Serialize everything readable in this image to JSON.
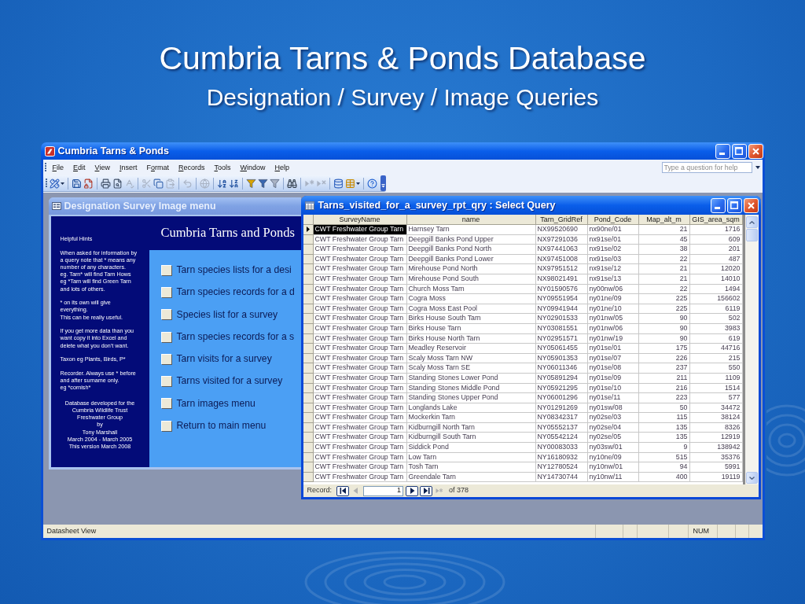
{
  "slide": {
    "title": "Cumbria Tarns & Ponds Database",
    "subtitle": "Designation / Survey / Image Queries"
  },
  "app_window": {
    "title": "Cumbria Tarns & Ponds",
    "menu": [
      {
        "key": "F",
        "post": "ile"
      },
      {
        "key": "E",
        "post": "dit"
      },
      {
        "key": "V",
        "post": "iew"
      },
      {
        "key": "I",
        "post": "nsert"
      },
      {
        "pre": "F",
        "key": "o",
        "post": "rmat"
      },
      {
        "key": "R",
        "post": "ecords"
      },
      {
        "key": "T",
        "post": "ools"
      },
      {
        "key": "W",
        "post": "indow"
      },
      {
        "key": "H",
        "post": "elp"
      }
    ],
    "help_box": {
      "placeholder": "Type a question for help"
    },
    "toolbar": [
      {
        "kind": "view",
        "disabled": false
      },
      {
        "kind": "separator"
      },
      {
        "kind": "save",
        "disabled": false
      },
      {
        "kind": "permission",
        "disabled": false
      },
      {
        "kind": "separator"
      },
      {
        "kind": "print",
        "disabled": false
      },
      {
        "kind": "preview",
        "disabled": false
      },
      {
        "kind": "spelling",
        "disabled": true
      },
      {
        "kind": "separator"
      },
      {
        "kind": "cut",
        "disabled": true
      },
      {
        "kind": "copy",
        "disabled": false
      },
      {
        "kind": "paste",
        "disabled": true
      },
      {
        "kind": "separator"
      },
      {
        "kind": "undo",
        "disabled": true
      },
      {
        "kind": "separator"
      },
      {
        "kind": "hyperlink",
        "disabled": true
      },
      {
        "kind": "separator"
      },
      {
        "kind": "sort_asc",
        "disabled": false
      },
      {
        "kind": "sort_desc",
        "disabled": false
      },
      {
        "kind": "separator"
      },
      {
        "kind": "filter_selection",
        "disabled": false
      },
      {
        "kind": "filter_form",
        "disabled": false
      },
      {
        "kind": "apply_filter",
        "disabled": true
      },
      {
        "kind": "separator"
      },
      {
        "kind": "find",
        "disabled": false
      },
      {
        "kind": "separator"
      },
      {
        "kind": "new_record",
        "disabled": true
      },
      {
        "kind": "delete_record",
        "disabled": true
      },
      {
        "kind": "separator"
      },
      {
        "kind": "database",
        "disabled": false
      },
      {
        "kind": "new_object",
        "disabled": false
      },
      {
        "kind": "separator"
      },
      {
        "kind": "help",
        "disabled": false
      }
    ]
  },
  "form_window": {
    "title": "Designation Survey Image menu",
    "hints": [
      {
        "kind": "heading",
        "lines": [
          "Helpful Hints"
        ]
      },
      {
        "kind": "paragraph",
        "lines": [
          "When asked for information by",
          "a query note that * means any",
          "number of any characters.",
          "eg. Tarn* will find Tarn Hows",
          "eg *Tarn will find Green Tarn",
          "and lots of others."
        ]
      },
      {
        "kind": "paragraph",
        "lines": [
          "* on its own will give",
          "everything.",
          "This can be really useful."
        ]
      },
      {
        "kind": "paragraph",
        "lines": [
          "If you get more data than you",
          "want copy it into Excel and",
          "delete what you don't want."
        ]
      },
      {
        "kind": "paragraph",
        "lines": [
          "Taxon eg Plants, Birds, P*"
        ]
      },
      {
        "kind": "paragraph",
        "lines": [
          "Recorder. Always use * before",
          "and after surname only.",
          "eg *cornish*"
        ]
      },
      {
        "kind": "credits",
        "lines": [
          "Database developed for the",
          "Cumbria Wildlife Trust",
          "Freshwater Group",
          "by",
          "Tony Marshall",
          "March 2004 - March 2005",
          "This version March 2008"
        ]
      }
    ],
    "heading": "Cumbria Tarns and Ponds",
    "options": [
      {
        "label": "Tarn species lists for a desi",
        "checked": false
      },
      {
        "label": "Tarn species records for a d",
        "checked": false
      },
      {
        "label": "Species list for a survey",
        "checked": false
      },
      {
        "label": "Tarn species records for a s",
        "checked": false
      },
      {
        "label": "Tarn visits for a survey",
        "checked": false
      },
      {
        "label": "Tarns visited for a survey",
        "checked": false
      },
      {
        "label": "Tarn images menu",
        "checked": false
      },
      {
        "label": "Return to main menu",
        "checked": false
      }
    ]
  },
  "query_window": {
    "title": "Tarns_visited_for_a_survey_rpt_qry : Select Query",
    "columns": [
      {
        "label": "SurveyName",
        "kind": "text"
      },
      {
        "label": "name",
        "kind": "text"
      },
      {
        "label": "Tarn_GridRef",
        "kind": "text"
      },
      {
        "label": "Pond_Code",
        "kind": "text"
      },
      {
        "label": "Map_alt_m",
        "kind": "number"
      },
      {
        "label": "GIS_area_sqm",
        "kind": "number"
      }
    ],
    "rows": [
      {
        "selected": true,
        "cells": [
          "CWT Freshwater Group Tarn",
          "Harnsey Tarn",
          "NX99520690",
          "nx90ne/01",
          "21",
          "1716"
        ]
      },
      {
        "selected": false,
        "cells": [
          "CWT Freshwater Group Tarn",
          "Deepgill Banks Pond Upper",
          "NX97291036",
          "nx91se/01",
          "45",
          "609"
        ]
      },
      {
        "selected": false,
        "cells": [
          "CWT Freshwater Group Tarn",
          "Deepgill Banks Pond North",
          "NX97441063",
          "nx91se/02",
          "38",
          "201"
        ]
      },
      {
        "selected": false,
        "cells": [
          "CWT Freshwater Group Tarn",
          "Deepgill Banks Pond Lower",
          "NX97451008",
          "nx91se/03",
          "22",
          "487"
        ]
      },
      {
        "selected": false,
        "cells": [
          "CWT Freshwater Group Tarn",
          "Mirehouse Pond North",
          "NX97951512",
          "nx91se/12",
          "21",
          "12020"
        ]
      },
      {
        "selected": false,
        "cells": [
          "CWT Freshwater Group Tarn",
          "Mirehouse Pond South",
          "NX98021491",
          "nx91se/13",
          "21",
          "14010"
        ]
      },
      {
        "selected": false,
        "cells": [
          "CWT Freshwater Group Tarn",
          "Church Moss Tarn",
          "NY01590576",
          "ny00nw/06",
          "22",
          "1494"
        ]
      },
      {
        "selected": false,
        "cells": [
          "CWT Freshwater Group Tarn",
          "Cogra Moss",
          "NY09551954",
          "ny01ne/09",
          "225",
          "156602"
        ]
      },
      {
        "selected": false,
        "cells": [
          "CWT Freshwater Group Tarn",
          "Cogra Moss East Pool",
          "NY09941944",
          "ny01ne/10",
          "225",
          "6119"
        ]
      },
      {
        "selected": false,
        "cells": [
          "CWT Freshwater Group Tarn",
          "Birks House South Tarn",
          "NY02901533",
          "ny01nw/05",
          "90",
          "502"
        ]
      },
      {
        "selected": false,
        "cells": [
          "CWT Freshwater Group Tarn",
          "Birks House Tarn",
          "NY03081551",
          "ny01nw/06",
          "90",
          "3983"
        ]
      },
      {
        "selected": false,
        "cells": [
          "CWT Freshwater Group Tarn",
          "Birks House North Tarn",
          "NY02951571",
          "ny01nw/19",
          "90",
          "619"
        ]
      },
      {
        "selected": false,
        "cells": [
          "CWT Freshwater Group Tarn",
          "Meadley Reservoir",
          "NY05061455",
          "ny01se/01",
          "175",
          "44716"
        ]
      },
      {
        "selected": false,
        "cells": [
          "CWT Freshwater Group Tarn",
          "Scaly Moss Tarn NW",
          "NY05901353",
          "ny01se/07",
          "226",
          "215"
        ]
      },
      {
        "selected": false,
        "cells": [
          "CWT Freshwater Group Tarn",
          "Scaly Moss Tarn SE",
          "NY06011346",
          "ny01se/08",
          "237",
          "550"
        ]
      },
      {
        "selected": false,
        "cells": [
          "CWT Freshwater Group Tarn",
          "Standing Stones Lower Pond",
          "NY05891294",
          "ny01se/09",
          "211",
          "1109"
        ]
      },
      {
        "selected": false,
        "cells": [
          "CWT Freshwater Group Tarn",
          "Standing Stones Middle Pond",
          "NY05921295",
          "ny01se/10",
          "216",
          "1514"
        ]
      },
      {
        "selected": false,
        "cells": [
          "CWT Freshwater Group Tarn",
          "Standing Stones Upper Pond",
          "NY06001296",
          "ny01se/11",
          "223",
          "577"
        ]
      },
      {
        "selected": false,
        "cells": [
          "CWT Freshwater Group Tarn",
          "Longlands Lake",
          "NY01291269",
          "ny01sw/08",
          "50",
          "34472"
        ]
      },
      {
        "selected": false,
        "cells": [
          "CWT Freshwater Group Tarn",
          "Mockerkin Tarn",
          "NY08342317",
          "ny02se/03",
          "115",
          "38124"
        ]
      },
      {
        "selected": false,
        "cells": [
          "CWT Freshwater Group Tarn",
          "Kidburngill North Tarn",
          "NY05552137",
          "ny02se/04",
          "135",
          "8326"
        ]
      },
      {
        "selected": false,
        "cells": [
          "CWT Freshwater Group Tarn",
          "Kidburngill South Tarn",
          "NY05542124",
          "ny02se/05",
          "135",
          "12919"
        ]
      },
      {
        "selected": false,
        "cells": [
          "CWT Freshwater Group Tarn",
          "Siddick Pond",
          "NY00083033",
          "ny03sw/01",
          "9",
          "138942"
        ]
      },
      {
        "selected": false,
        "cells": [
          "CWT Freshwater Group Tarn",
          "Low Tarn",
          "NY16180932",
          "ny10ne/09",
          "515",
          "35376"
        ]
      },
      {
        "selected": false,
        "cells": [
          "CWT Freshwater Group Tarn",
          "Tosh Tarn",
          "NY12780524",
          "ny10nw/01",
          "94",
          "5991"
        ]
      },
      {
        "selected": false,
        "cells": [
          "CWT Freshwater Group Tarn",
          "Greendale Tarn",
          "NY14730744",
          "ny10nw/11",
          "400",
          "19119"
        ]
      }
    ],
    "navigator": {
      "label": "Record:",
      "controls": [
        {
          "kind": "first",
          "disabled": false
        },
        {
          "kind": "prev",
          "disabled": true
        },
        {
          "kind": "field",
          "value": "1"
        },
        {
          "kind": "next",
          "disabled": false
        },
        {
          "kind": "last",
          "disabled": false
        },
        {
          "kind": "new",
          "disabled": true
        }
      ],
      "total": "of 378"
    }
  },
  "status_bar": {
    "mode": "Datasheet View",
    "indicators": [
      "NUM"
    ]
  }
}
